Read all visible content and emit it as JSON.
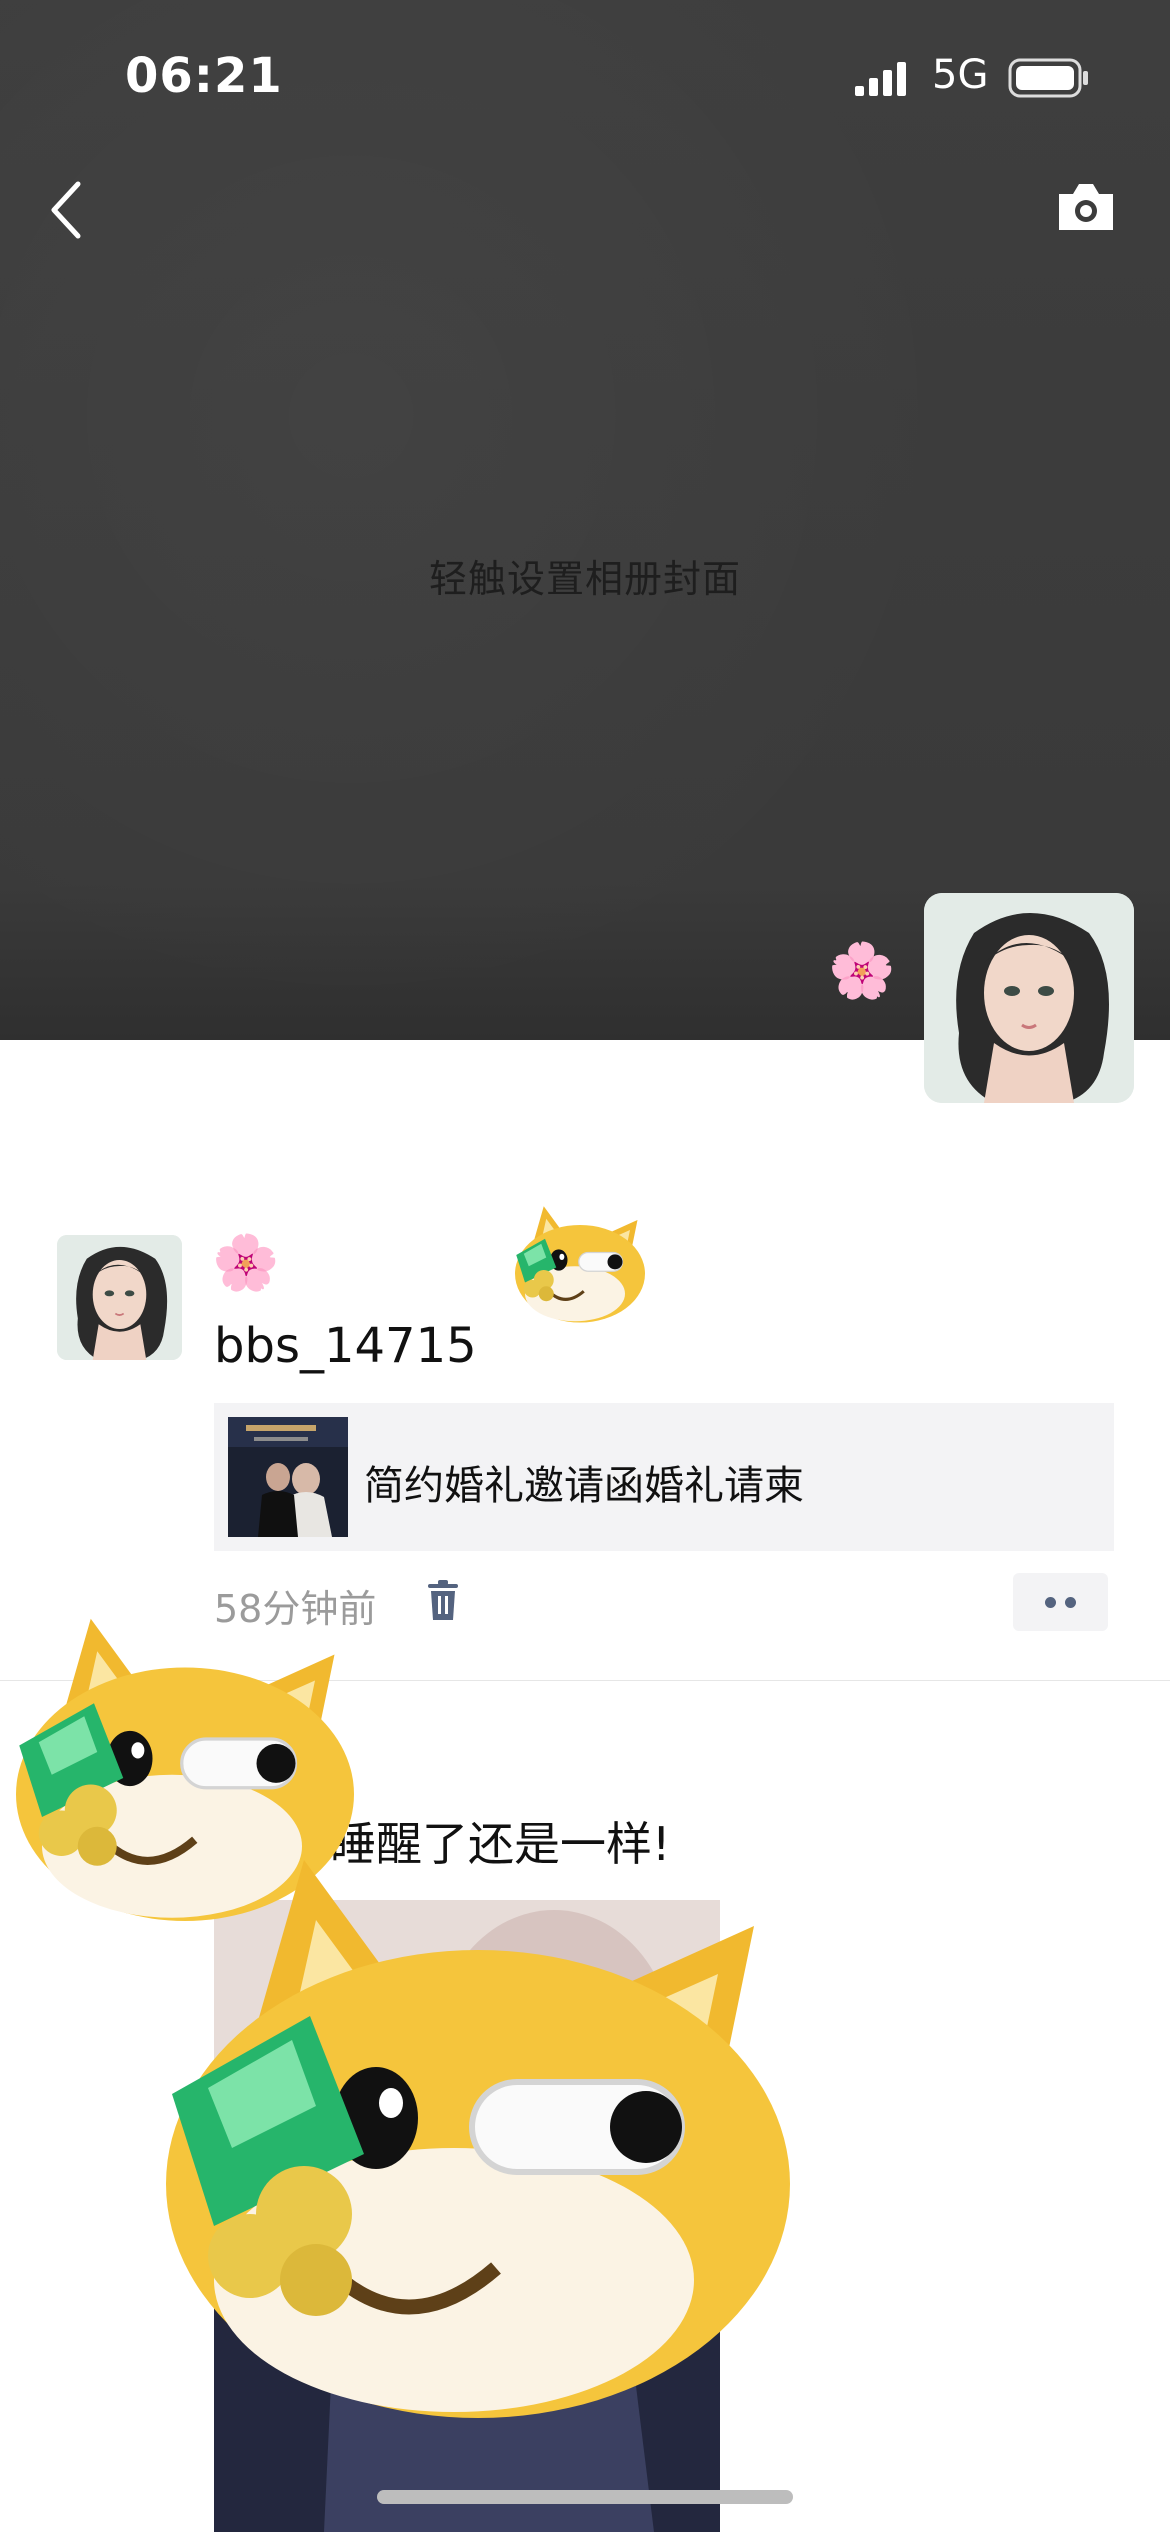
{
  "status_bar": {
    "time": "06:21",
    "network": "5G"
  },
  "cover": {
    "hint": "轻触设置相册封面"
  },
  "icons": {
    "back": "chevron-left-icon",
    "camera": "camera-icon",
    "flower": "cherry-blossom-emoji",
    "trash": "trash-icon",
    "more": "more-dots-icon"
  },
  "posts": [
    {
      "username": "bbs_14715",
      "link_title": "简约婚礼邀请函婚礼请柬",
      "time": "58分钟前"
    },
    {
      "text": "睡醒了还是一样!"
    }
  ],
  "colors": {
    "cover_bg": "#3c3c3c",
    "link_bg": "#f3f3f5",
    "meta_text": "#9b9b9b",
    "accent_blue": "#54637f",
    "sticker_yellow": "#f3c23a"
  }
}
